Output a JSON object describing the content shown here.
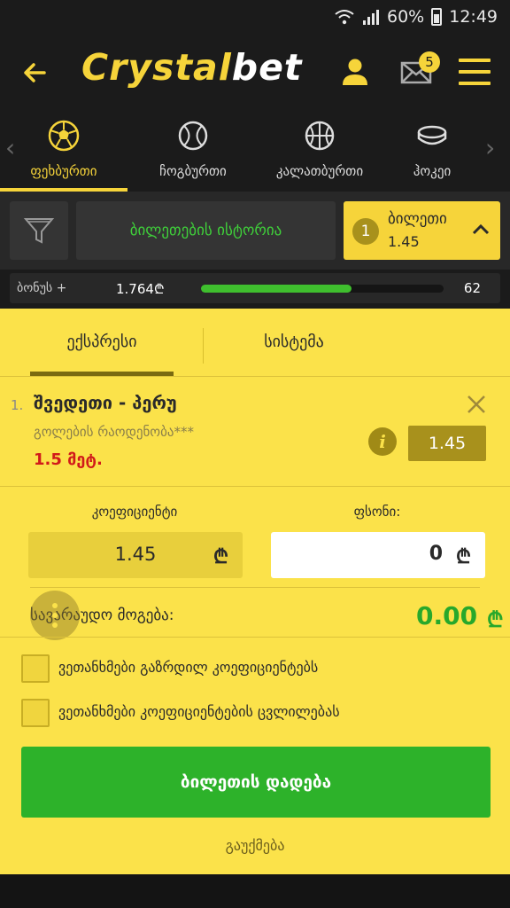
{
  "status_bar": {
    "battery": "60%",
    "time": "12:49"
  },
  "header": {
    "logo_part1": "Crystal",
    "logo_part2": "bet",
    "mail_badge": "5"
  },
  "sports": [
    {
      "label": "ფეხბურთი",
      "icon": "soccer-ball-icon"
    },
    {
      "label": "ჩოგბურთი",
      "icon": "tennis-ball-icon"
    },
    {
      "label": "კალათბურთი",
      "icon": "basketball-icon"
    },
    {
      "label": "ჰოკეი",
      "icon": "hockey-puck-icon"
    }
  ],
  "filter_row": {
    "history_label": "ბილეთების ისტორია",
    "ticket_count": "1",
    "ticket_label": "ბილეთი",
    "ticket_odds": "1.45"
  },
  "bonus": {
    "label": "ბონუს +",
    "amount": "1.764₾",
    "percent": "62",
    "progress": 0.62
  },
  "betslip": {
    "tabs": [
      "ექსპრესი",
      "სისტემა"
    ],
    "bet": {
      "index": "1.",
      "match": "შვედეთი - პერუ",
      "market": "გოლების რაოდენობა***",
      "pick": "1.5 მეტ.",
      "odds": "1.45"
    },
    "coef_label": "კოეფიციენტი",
    "coef_value": "1.45",
    "stake_label": "ფსონი:",
    "stake_value": "0",
    "currency": "₾",
    "win_label": "სავარაუდო მოგება:",
    "win_amount": "0.00",
    "checks": [
      "ვეთანხმები გაზრდილ კოეფიციენტებს",
      "ვეთანხმები კოეფიციენტების ცვლილებას"
    ],
    "place_label": "ბილეთის დადება",
    "cancel_label": "გაუქმება"
  },
  "colors": {
    "accent": "#f6d43a",
    "panel": "#fbe24a",
    "green": "#2db22a",
    "red": "#d11a1a"
  }
}
